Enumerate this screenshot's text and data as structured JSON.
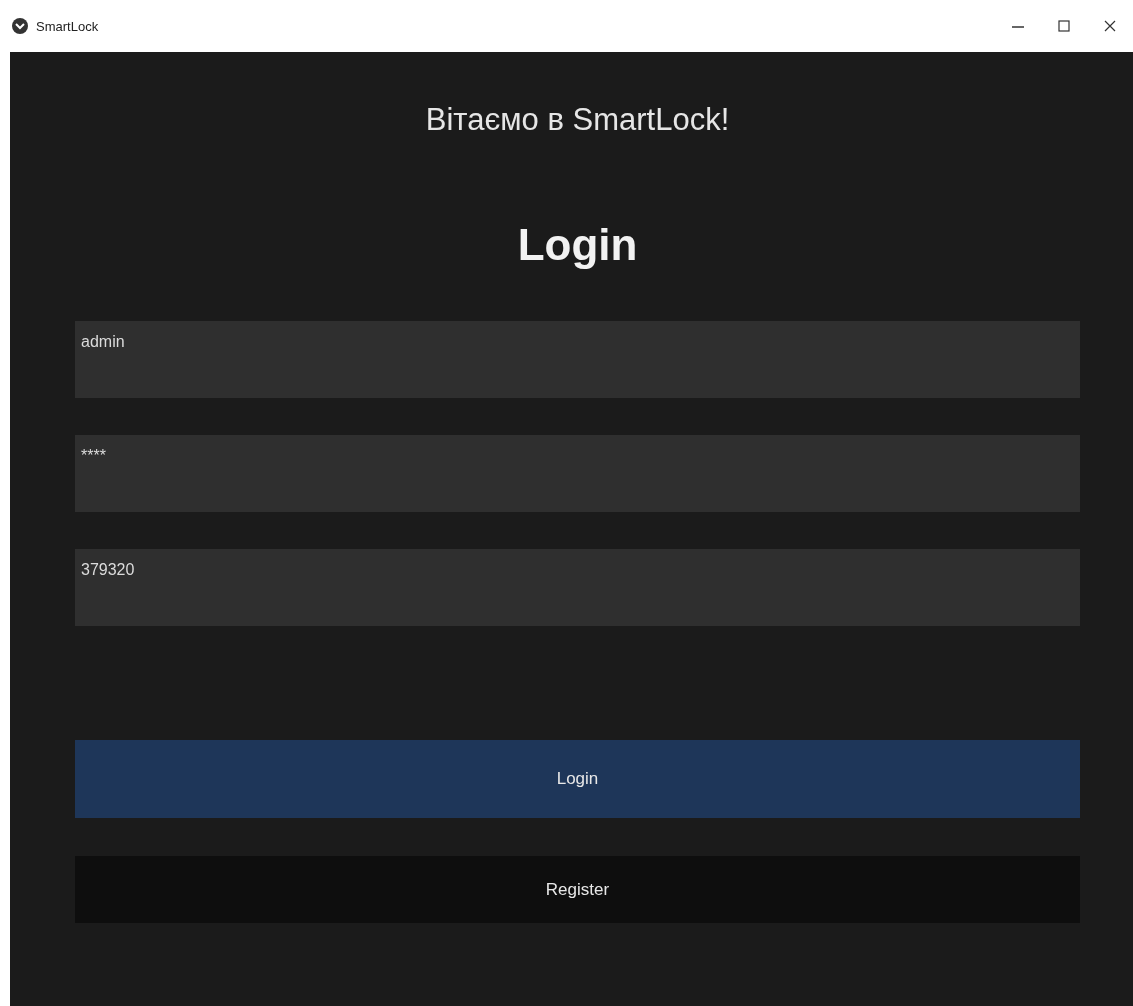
{
  "window": {
    "title": "SmartLock"
  },
  "greeting": "Вітаємо в SmartLock!",
  "heading": "Login",
  "fields": [
    {
      "value": "admin"
    },
    {
      "value": "****"
    },
    {
      "value": "379320"
    }
  ],
  "buttons": [
    {
      "label": "Login",
      "kind": "primary"
    },
    {
      "label": "Register",
      "kind": "secondary"
    }
  ]
}
